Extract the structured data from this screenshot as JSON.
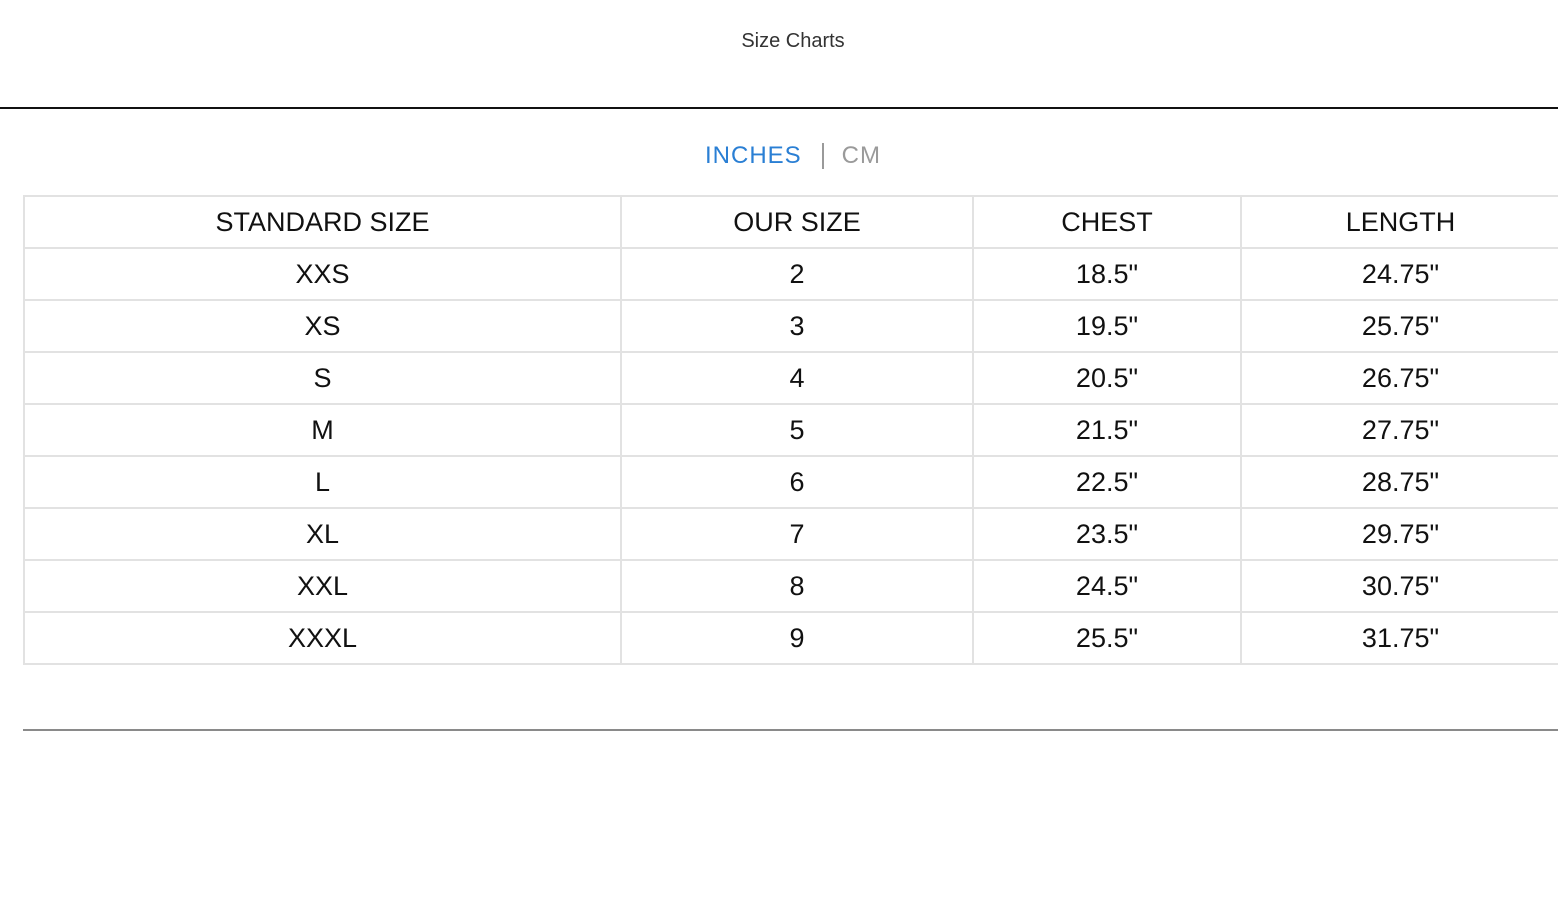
{
  "header": {
    "title": "Size Charts"
  },
  "unit_toggle": {
    "options": [
      "INCHES",
      "CM"
    ],
    "selected": "INCHES",
    "active_color": "#2a7fd4",
    "inactive_color": "#9a9a9a"
  },
  "table": {
    "columns": [
      "STANDARD SIZE",
      "OUR SIZE",
      "CHEST",
      "LENGTH"
    ],
    "rows": [
      [
        "XXS",
        "2",
        "18.5\"",
        "24.75\""
      ],
      [
        "XS",
        "3",
        "19.5\"",
        "25.75\""
      ],
      [
        "S",
        "4",
        "20.5\"",
        "26.75\""
      ],
      [
        "M",
        "5",
        "21.5\"",
        "27.75\""
      ],
      [
        "L",
        "6",
        "22.5\"",
        "28.75\""
      ],
      [
        "XL",
        "7",
        "23.5\"",
        "29.75\""
      ],
      [
        "XXL",
        "8",
        "24.5\"",
        "30.75\""
      ],
      [
        "XXXL",
        "9",
        "25.5\"",
        "31.75\""
      ]
    ]
  }
}
